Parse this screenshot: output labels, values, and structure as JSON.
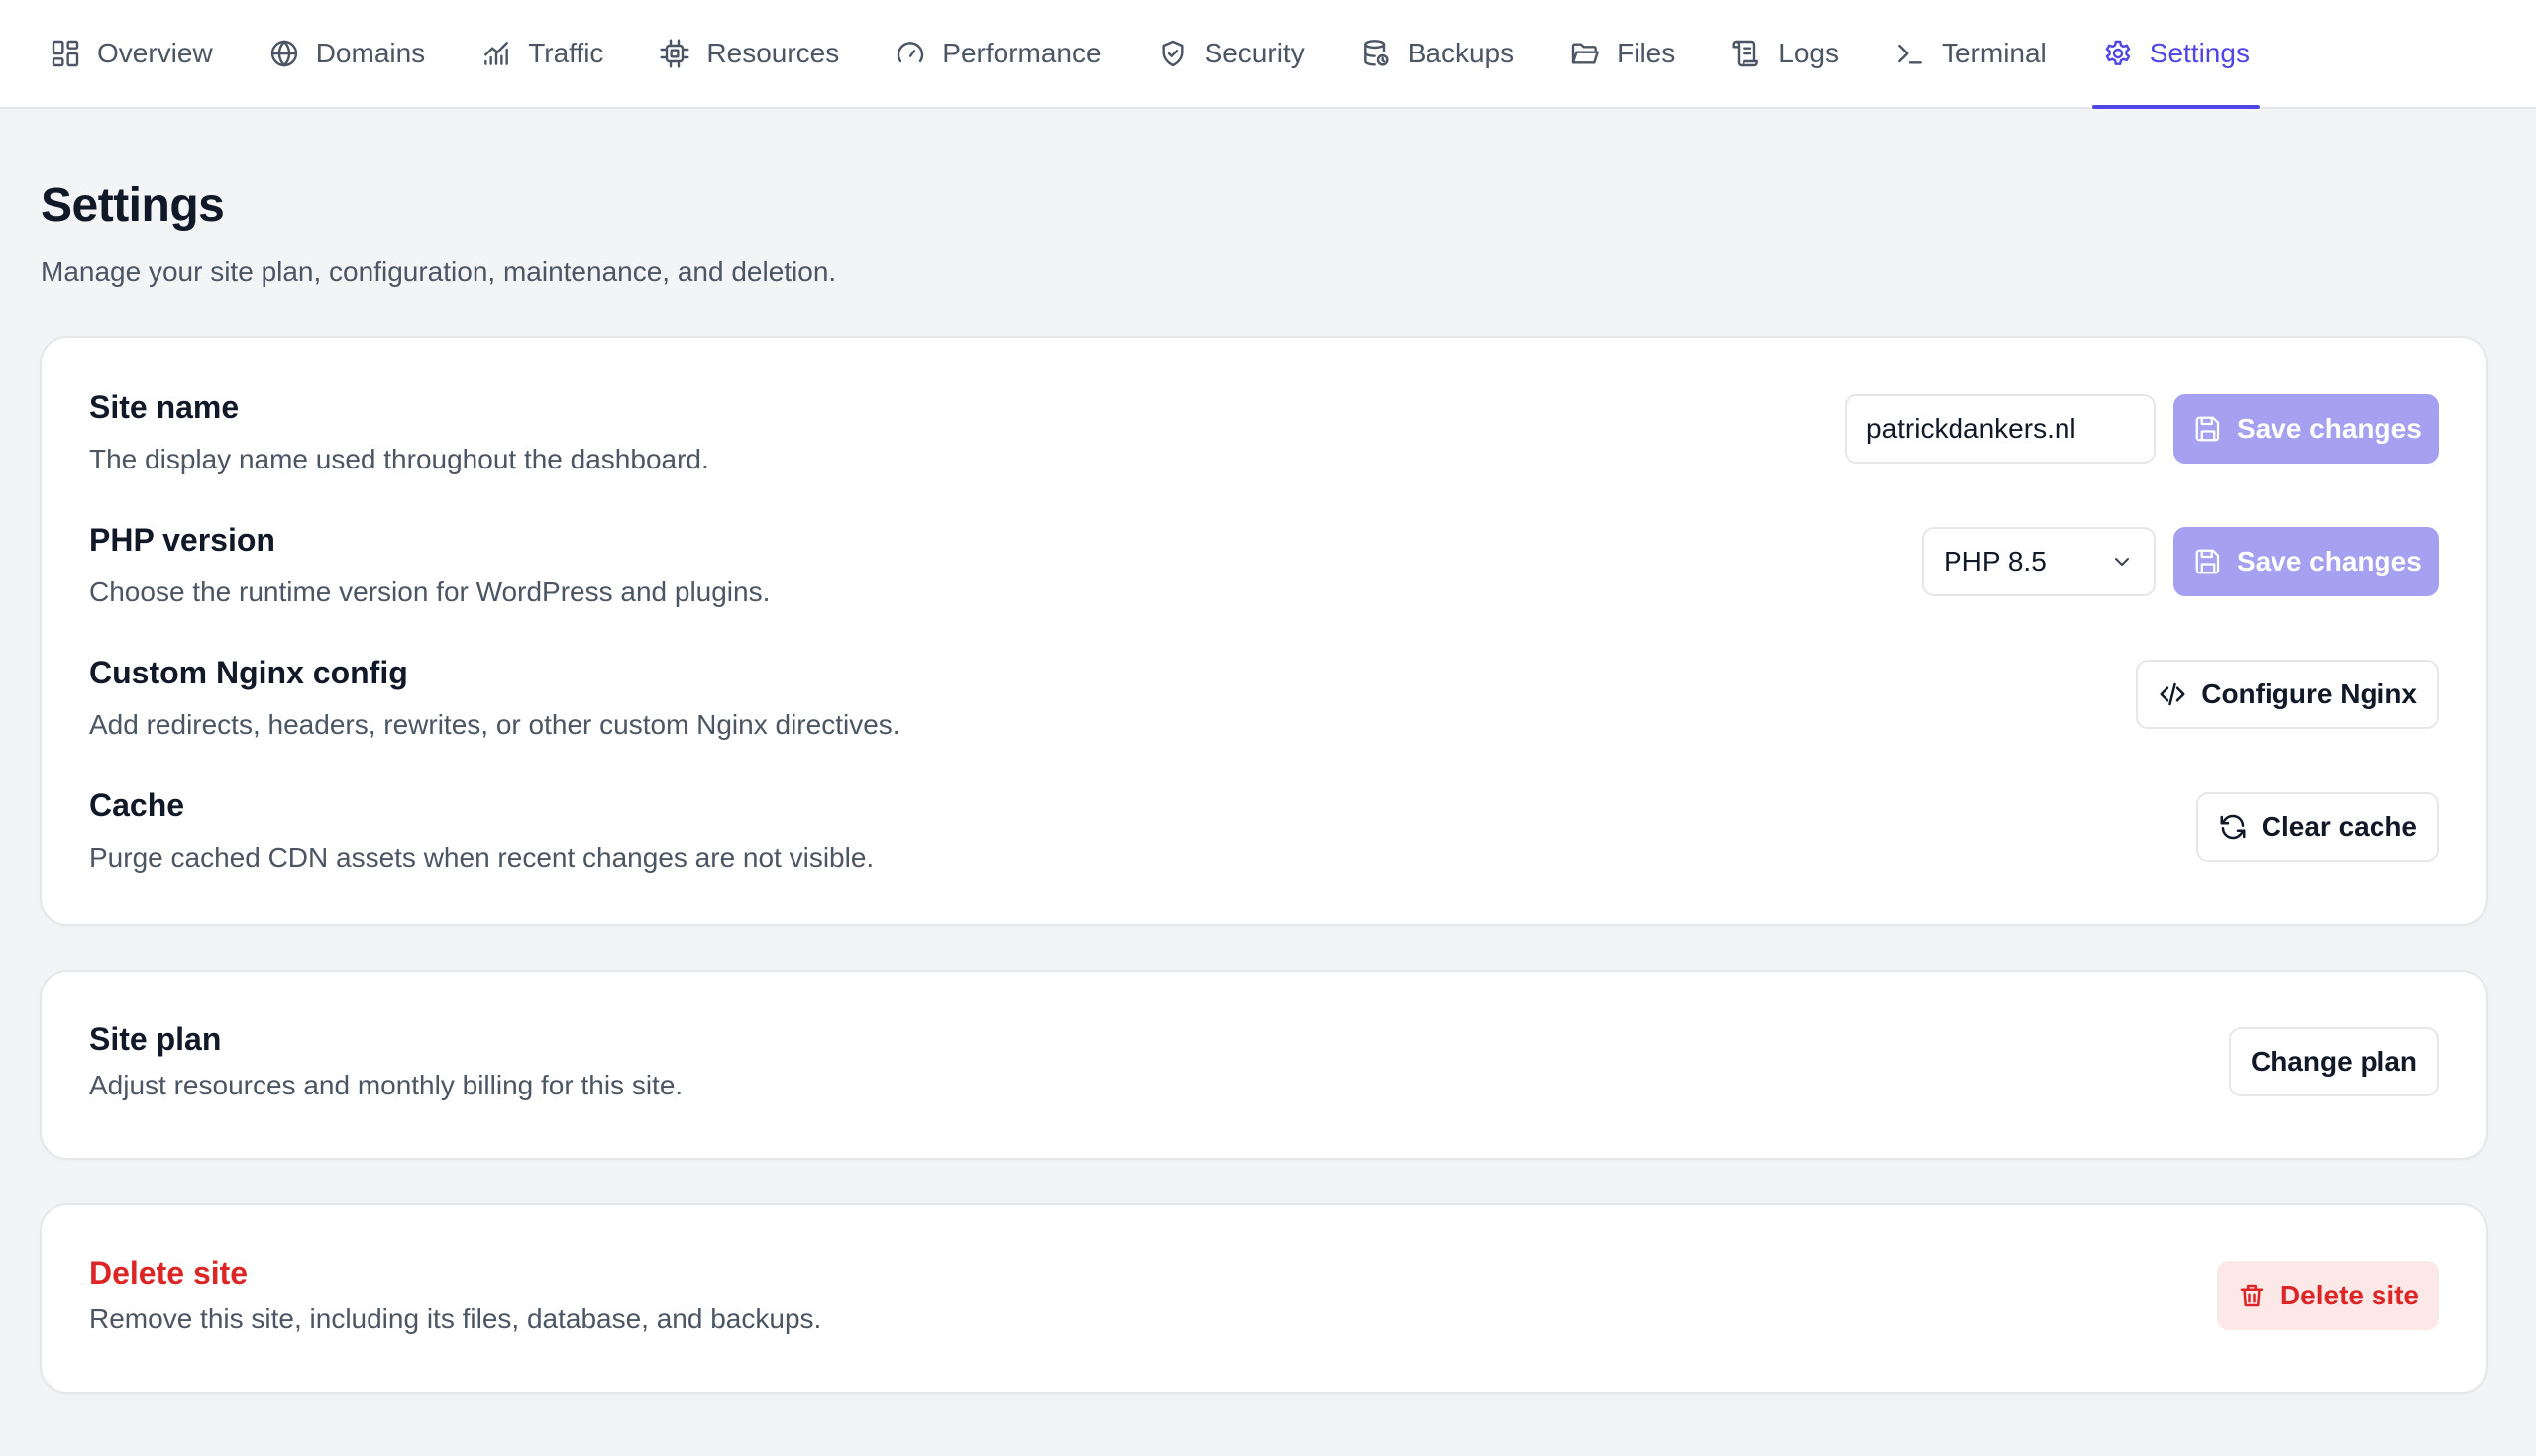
{
  "nav": {
    "tabs": [
      {
        "label": "Overview",
        "icon": "grid-icon"
      },
      {
        "label": "Domains",
        "icon": "globe-icon"
      },
      {
        "label": "Traffic",
        "icon": "chart-icon"
      },
      {
        "label": "Resources",
        "icon": "chip-icon"
      },
      {
        "label": "Performance",
        "icon": "gauge-icon"
      },
      {
        "label": "Security",
        "icon": "shield-icon"
      },
      {
        "label": "Backups",
        "icon": "database-icon"
      },
      {
        "label": "Files",
        "icon": "folder-icon"
      },
      {
        "label": "Logs",
        "icon": "scroll-icon"
      },
      {
        "label": "Terminal",
        "icon": "terminal-icon"
      },
      {
        "label": "Settings",
        "icon": "gear-icon",
        "active": true
      }
    ],
    "accent": "#4f46e5"
  },
  "page": {
    "title": "Settings",
    "subtitle": "Manage your site plan, configuration, maintenance, and deletion."
  },
  "site_name": {
    "title": "Site name",
    "desc": "The display name used throughout the dashboard.",
    "value": "patrickdankers.nl",
    "save_label": "Save changes"
  },
  "php_version": {
    "title": "PHP version",
    "desc": "Choose the runtime version for WordPress and plugins.",
    "selected": "PHP 8.5",
    "save_label": "Save changes"
  },
  "nginx": {
    "title": "Custom Nginx config",
    "desc": "Add redirects, headers, rewrites, or other custom Nginx directives.",
    "button_label": "Configure Nginx"
  },
  "cache": {
    "title": "Cache",
    "desc": "Purge cached CDN assets when recent changes are not visible.",
    "button_label": "Clear cache"
  },
  "plan": {
    "title": "Site plan",
    "desc": "Adjust resources and monthly billing for this site.",
    "button_label": "Change plan"
  },
  "delete": {
    "title": "Delete site",
    "desc": "Remove this site, including its files, database, and backups.",
    "button_label": "Delete site",
    "color": "#dc2626"
  }
}
